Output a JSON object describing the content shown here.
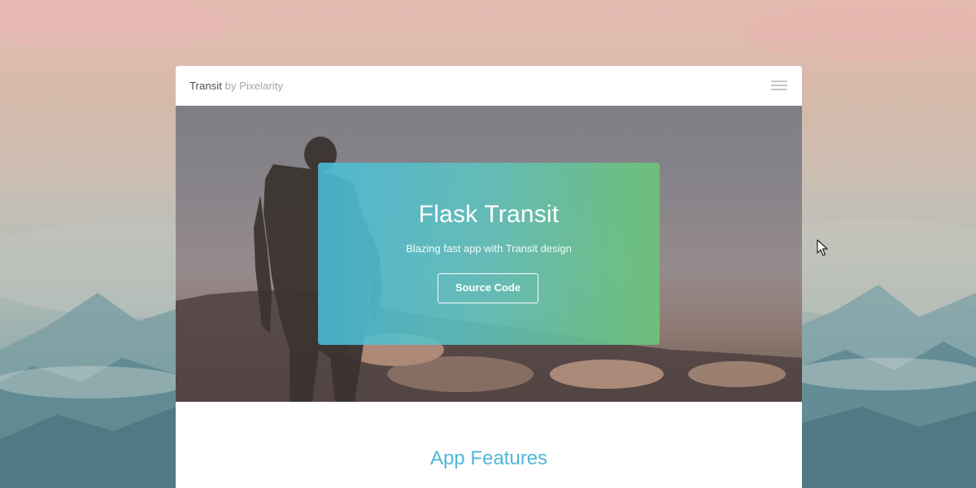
{
  "header": {
    "brand_main": "Transit",
    "brand_sub": " by Pixelarity",
    "menu_icon": "hamburger-menu-icon"
  },
  "hero": {
    "title": "Flask Transit",
    "subtitle": "Blazing fast app with Transit design",
    "button_label": "Source Code"
  },
  "features": {
    "title": "App Features"
  },
  "colors": {
    "accent": "#4fb7d8",
    "gradient_start": "#49bedA",
    "gradient_end": "#6cc378",
    "card_bg": "#ffffff",
    "brand_text": "#4d4d4d",
    "brand_muted": "#a6a6a6"
  },
  "icons": {
    "cursor": "mouse-pointer-icon"
  }
}
